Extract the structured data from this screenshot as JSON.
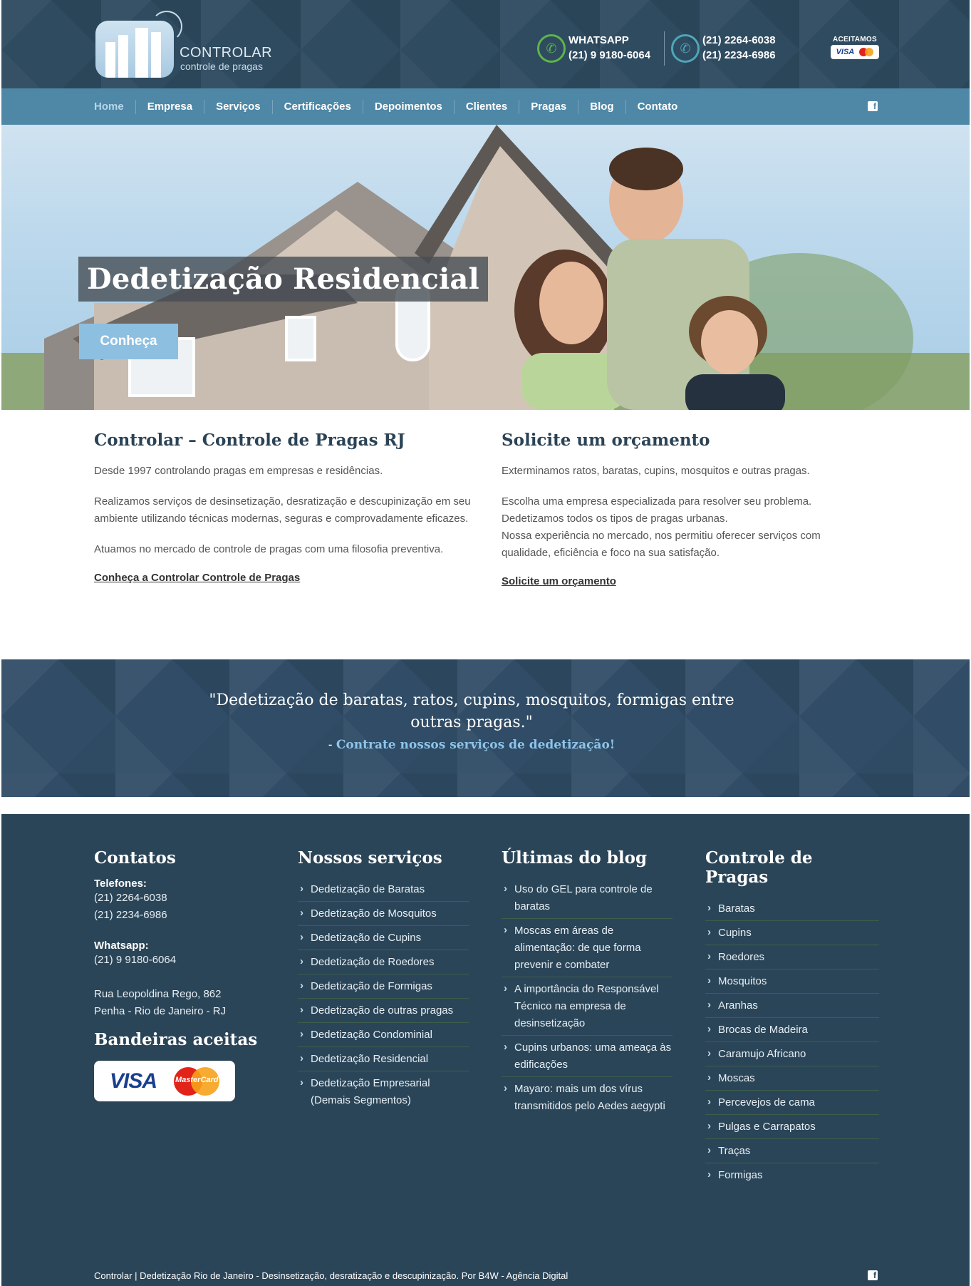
{
  "header": {
    "logo_name": "CONTROLAR",
    "logo_sub": "controle de pragas",
    "whatsapp_label": "WHATSAPP",
    "whatsapp_number": "(21) 9 9180-6064",
    "phone_1": "(21) 2264-6038",
    "phone_2": "(21) 2234-6986",
    "accept_label": "ACEITAMOS",
    "accept_visa": "VISA"
  },
  "nav": {
    "items": [
      "Home",
      "Empresa",
      "Serviços",
      "Certificações",
      "Depoimentos",
      "Clientes",
      "Pragas",
      "Blog",
      "Contato"
    ],
    "facebook_icon": "facebook-icon"
  },
  "hero": {
    "title": "Dedetização Residencial",
    "button": "Conheça"
  },
  "about": {
    "title": "Controlar – Controle de Pragas RJ",
    "p1": "Desde 1997 controlando pragas em empresas e residências.",
    "p2": "Realizamos serviços de desinsetização, desratização e descupinização em seu ambiente utilizando técnicas modernas, seguras e comprovadamente eficazes.",
    "p3": "Atuamos no mercado de controle de pragas com uma filosofia preventiva.",
    "link": "Conheça a Controlar Controle de Pragas"
  },
  "quote_box": {
    "title": "Solicite um orçamento",
    "p1": "Exterminamos ratos, baratas, cupins, mosquitos e outras pragas.",
    "p2a": "Escolha uma empresa especializada para resolver seu problema.",
    "p2b": "Dedetizamos todos os tipos de pragas urbanas.",
    "p2c": "Nossa experiência no mercado, nos permitiu oferecer serviços com qualidade, eficiência e foco na sua satisfação.",
    "link": "Solicite um orçamento"
  },
  "testimonial": {
    "text": "\"Dedetização de baratas, ratos, cupins, mosquitos, formigas entre outras pragas.\"",
    "dash": "- ",
    "author": "Contrate nossos serviços de dedetização!"
  },
  "footer": {
    "contacts": {
      "title": "Contatos",
      "phones_label": "Telefones:",
      "phone_1": "(21) 2264-6038",
      "phone_2": "(21) 2234-6986",
      "whatsapp_label": "Whatsapp:",
      "whatsapp": "(21) 9 9180-6064",
      "address_1": "Rua Leopoldina Rego, 862",
      "address_2": "Penha - Rio de Janeiro - RJ",
      "cards_title": "Bandeiras aceitas",
      "visa": "VISA",
      "mastercard": "MasterCard"
    },
    "services": {
      "title": "Nossos serviços",
      "items": [
        "Dedetização de Baratas",
        "Dedetização de Mosquitos",
        "Dedetização de Cupins",
        "Dedetização de Roedores",
        "Dedetização de Formigas",
        "Dedetização de outras pragas",
        "Dedetização Condominial",
        "Dedetização Residencial",
        "Dedetização Empresarial (Demais Segmentos)"
      ]
    },
    "blog": {
      "title": "Últimas do blog",
      "items": [
        "Uso do GEL para controle de baratas",
        "Moscas em áreas de alimentação: de que forma prevenir e combater",
        "A importância do Responsável Técnico na empresa de desinsetização",
        "Cupins urbanos: uma ameaça às edificações",
        "Mayaro: mais um dos vírus transmitidos pelo Aedes aegypti"
      ]
    },
    "pests": {
      "title": "Controle de Pragas",
      "items": [
        "Baratas",
        "Cupins",
        "Roedores",
        "Mosquitos",
        "Aranhas",
        "Brocas de Madeira",
        "Caramujo Africano",
        "Moscas",
        "Percevejos de cama",
        "Pulgas e Carrapatos",
        "Traças",
        "Formigas"
      ]
    },
    "bottom_text": "Controlar | Dedetização Rio de Janeiro - Desinsetização, desratização e descupinização. Por B4W - Agência Digital"
  }
}
